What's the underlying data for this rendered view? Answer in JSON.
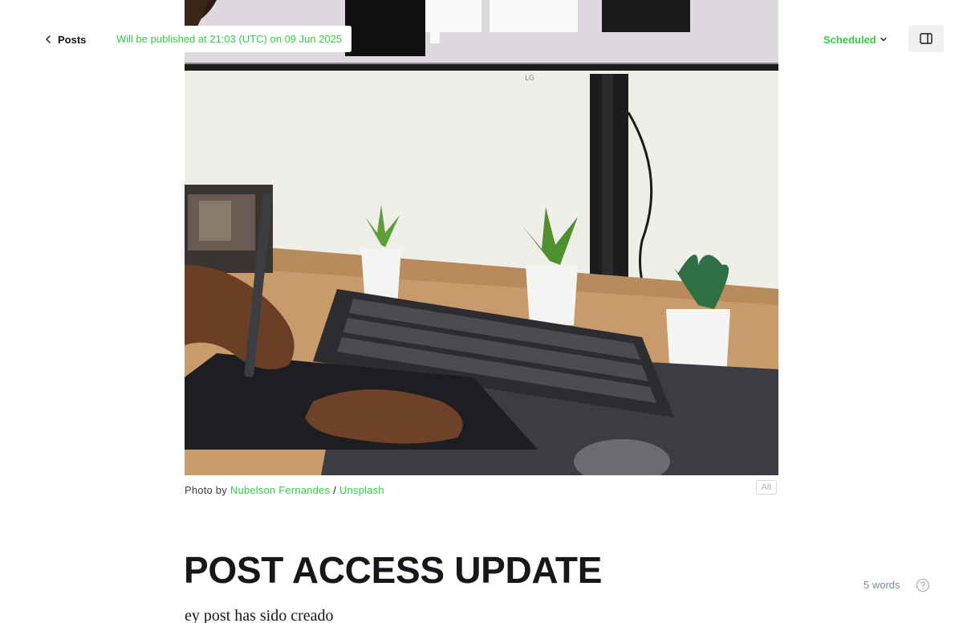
{
  "header": {
    "back_label": "Posts",
    "publish_note": "Will be published at 21:03 (UTC) on 09 Jun 2025",
    "status_label": "Scheduled",
    "status_color": "#30cf43"
  },
  "icons": {
    "back": "chevron-left-icon",
    "status": "chevron-down-icon",
    "sidebar": "sidebar-panel-icon",
    "help": "question-circle-icon"
  },
  "feature_image": {
    "caption_prefix": "Photo by",
    "author": "Nubelson Fernandes",
    "separator": "/",
    "source": "Unsplash",
    "alt_label": "Alt",
    "monitor_brand": "LG"
  },
  "post": {
    "title": "POST ACCESS UPDATE",
    "body": "ey post has sido creado"
  },
  "footer": {
    "word_count": "5 words"
  },
  "colors": {
    "accent": "#30cf43",
    "text": "#15171a",
    "muted": "#7c8b9a"
  }
}
